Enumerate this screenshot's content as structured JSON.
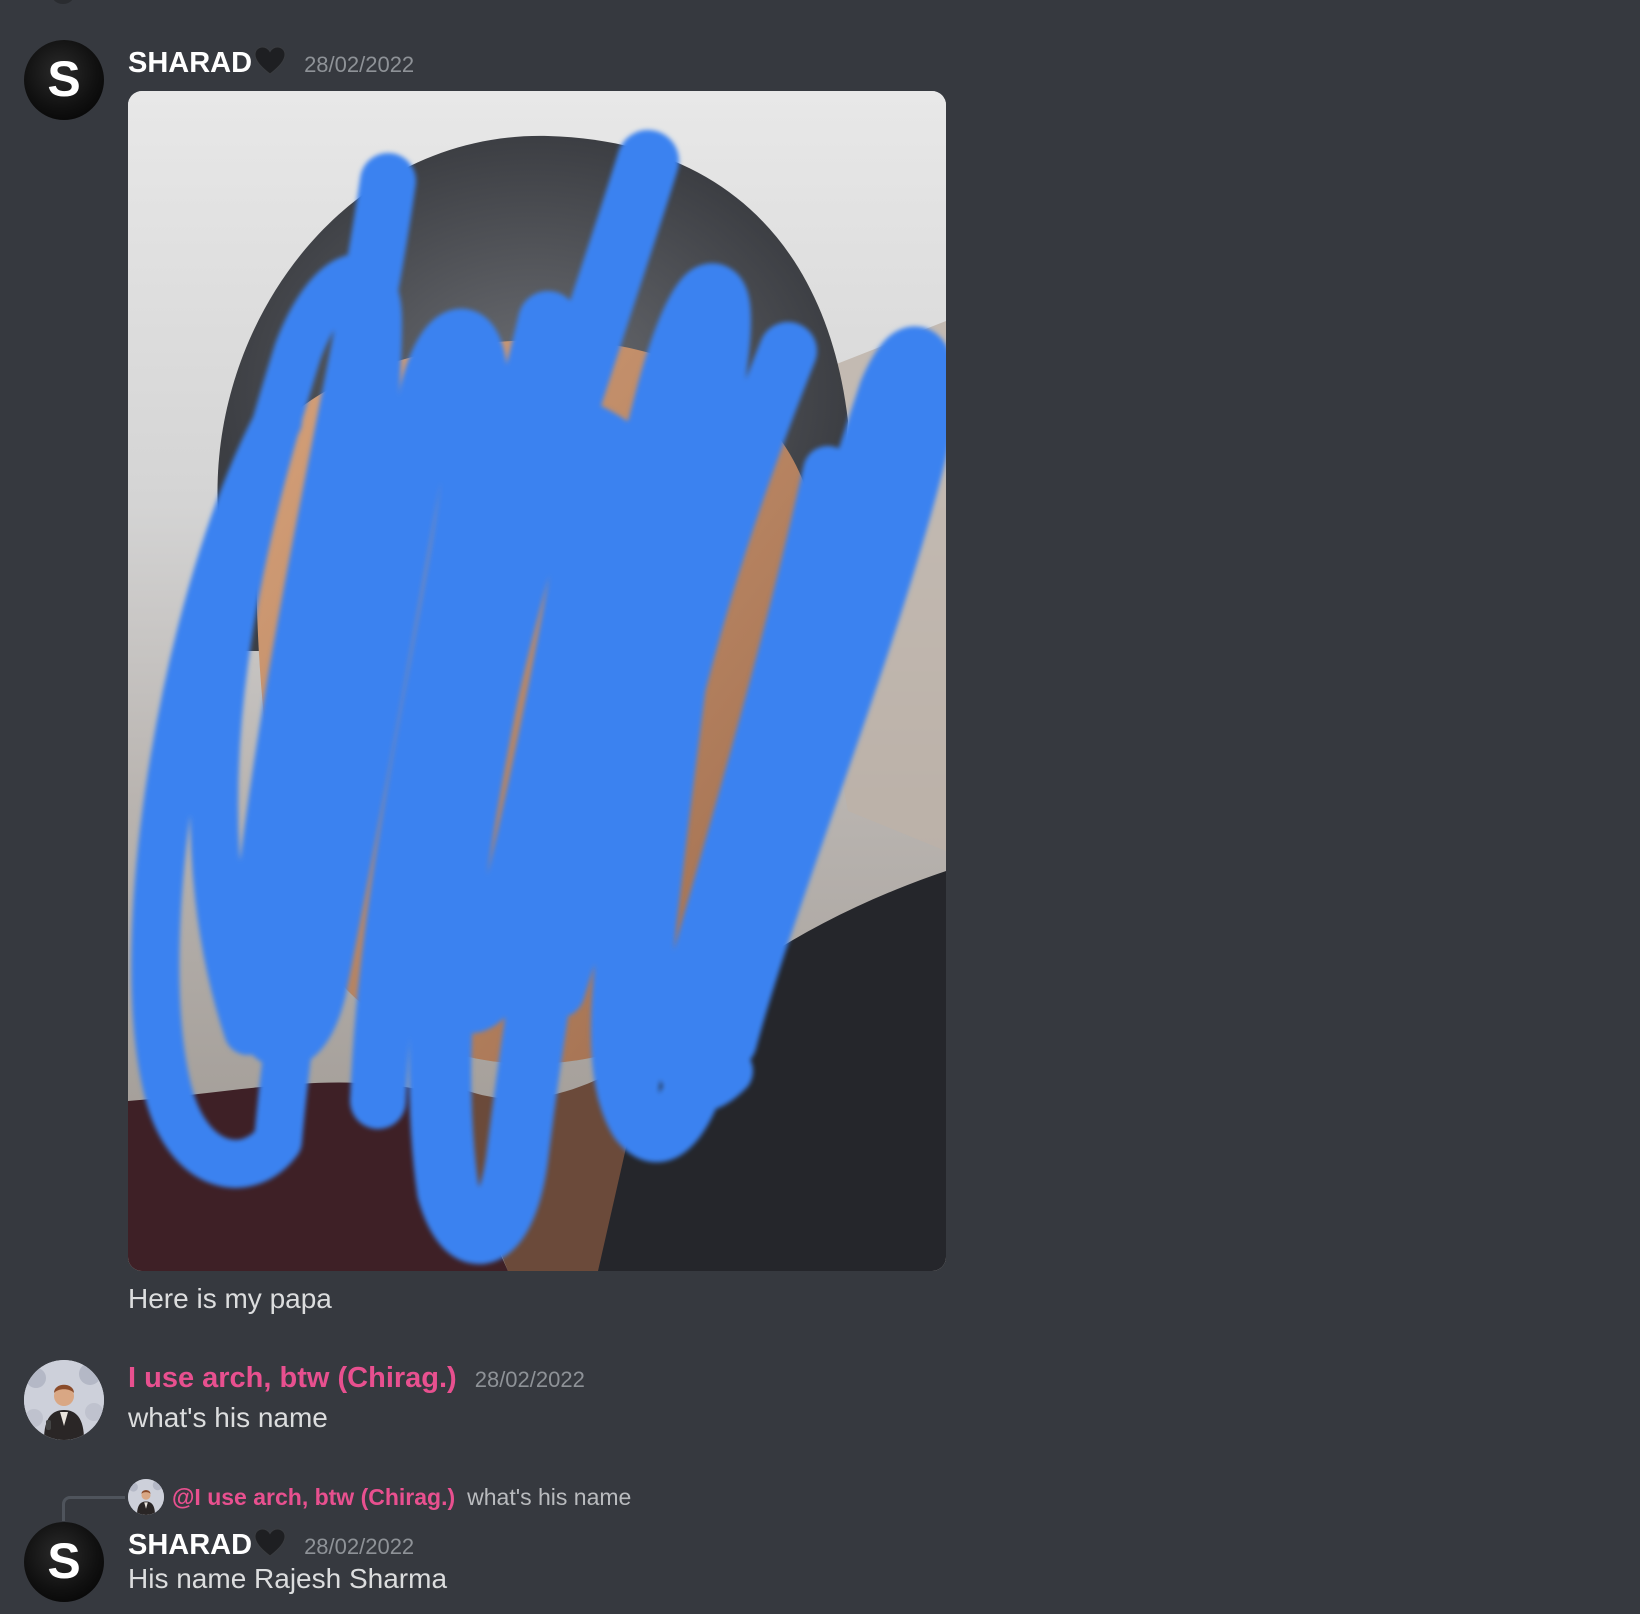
{
  "messages": [
    {
      "author": "SHARAD",
      "avatar_letter": "S",
      "author_decoration": "black-heart-icon",
      "timestamp": "28/02/2022",
      "attachment": "photo-with-blue-scribble",
      "text": "Here is my papa"
    },
    {
      "author": "I use arch, btw (Chirag.)",
      "author_color": "#e8508f",
      "timestamp": "28/02/2022",
      "text": "what's his name"
    },
    {
      "author": "SHARAD",
      "avatar_letter": "S",
      "author_decoration": "black-heart-icon",
      "timestamp": "28/02/2022",
      "reply": {
        "mention": "@I use arch, btw (Chirag.)",
        "text": "what's his name"
      },
      "text": "His name Rajesh Sharma"
    }
  ],
  "colors": {
    "background": "#36393f",
    "text": "#dcddde",
    "timestamp": "#8e9297",
    "mention": "#e8508f",
    "scribble": "#3b82f0"
  }
}
